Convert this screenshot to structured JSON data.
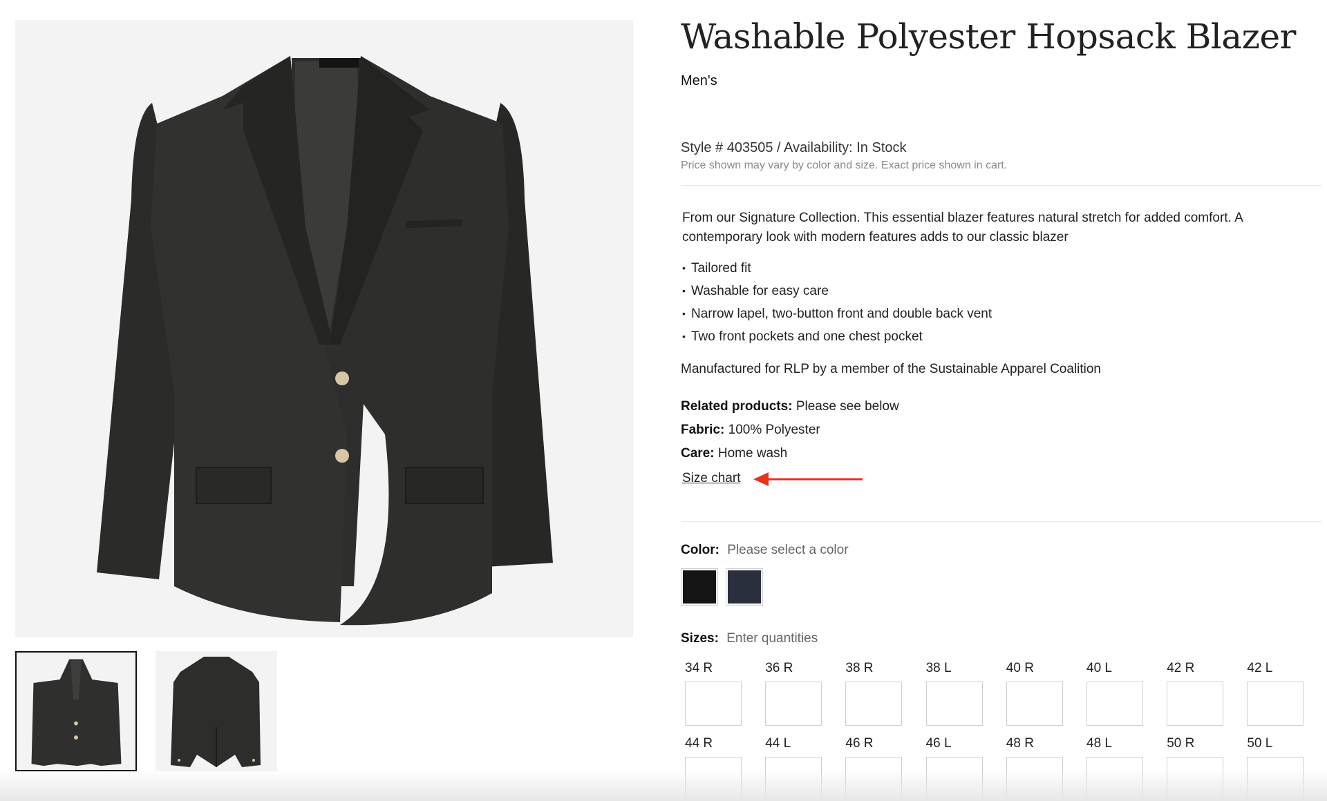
{
  "gallery": {
    "main_image_icon": "blazer-front-image",
    "thumbnails": [
      {
        "icon": "blazer-front-thumbnail",
        "selected": true
      },
      {
        "icon": "blazer-back-thumbnail",
        "selected": false
      }
    ]
  },
  "product": {
    "title": "Washable Polyester Hopsack Blazer",
    "gender": "Men's",
    "style_line": "Style # 403505 / Availability: In Stock",
    "price_note": "Price shown may vary by color and size. Exact price shown in cart.",
    "description": "From our Signature Collection. This essential blazer features natural stretch for added comfort. A contemporary look with modern features adds to our classic blazer",
    "features": [
      "Tailored fit",
      "Washable for easy care",
      "Narrow lapel, two-button front and double back vent",
      "Two front pockets and one chest pocket"
    ],
    "manufactured": "Manufactured for RLP by a member of the Sustainable Apparel Coalition",
    "related_label": "Related products:",
    "related_value": "Please see below",
    "fabric_label": "Fabric:",
    "fabric_value": "100% Polyester",
    "care_label": "Care:",
    "care_value": "Home wash",
    "size_chart_link": "Size chart"
  },
  "annotation": {
    "icon": "red-arrow-icon",
    "color": "#e8321c"
  },
  "color_selector": {
    "label": "Color:",
    "placeholder": "Please select a color",
    "swatches": [
      {
        "name": "black",
        "hex": "#141414"
      },
      {
        "name": "navy",
        "hex": "#2a2f3d"
      }
    ]
  },
  "sizes": {
    "label": "Sizes:",
    "hint": "Enter quantities",
    "row1": [
      "34 R",
      "36 R",
      "38 R",
      "38 L",
      "40 R",
      "40 L",
      "42 R",
      "42 L"
    ],
    "row2": [
      "44 R",
      "44 L",
      "46 R",
      "46 L",
      "48 R",
      "48 L",
      "50 R",
      "50 L"
    ]
  }
}
